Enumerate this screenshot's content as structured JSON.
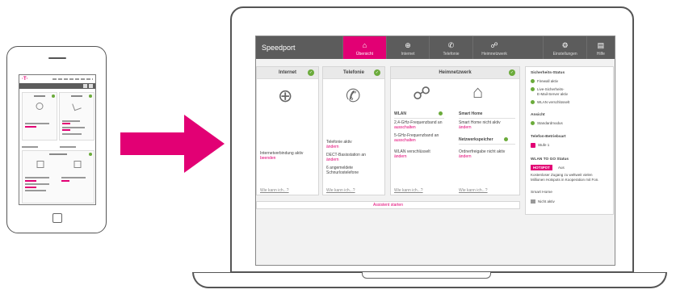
{
  "router": {
    "brand": "Speedport",
    "nav": [
      {
        "label": "Übersicht",
        "icon": "home-icon",
        "glyph": "⌂"
      },
      {
        "label": "Internet",
        "icon": "globe-icon",
        "glyph": "⊕"
      },
      {
        "label": "Telefonie",
        "icon": "phone-icon",
        "glyph": "✆"
      },
      {
        "label": "Heimnetzwerk",
        "icon": "network-icon",
        "glyph": "☍"
      },
      {
        "label": "Einstellungen",
        "icon": "gear-icon",
        "glyph": "⚙"
      },
      {
        "label": "Hilfe",
        "icon": "book-icon",
        "glyph": "▤"
      }
    ]
  },
  "internet_card": {
    "title": "Internet",
    "status": "Internetverbindung aktiv",
    "action": "beenden",
    "help": "Wie kann ich...?"
  },
  "telefonie_card": {
    "title": "Telefonie",
    "line1": "Telefonie aktiv",
    "action1": "ändern",
    "line2": "DECT-Basisstation an",
    "action2": "ändern",
    "line3a": "6 angemeldete",
    "line3b": "Schnurlostelefone",
    "help": "Wie kann ich...?"
  },
  "heimnetz_card": {
    "title": "Heimnetzwerk",
    "wlan_title": "WLAN",
    "wlan_line1": "2,4-GHz-Frequenzband an",
    "wlan_action1": "ausschalten",
    "wlan_line2": "5-GHz-Frequenzband an",
    "wlan_action2": "ausschalten",
    "wlan_line3": "WLAN verschlüsselt",
    "wlan_action3": "ändern",
    "smart_title": "Smart Home",
    "smart_line": "Smart Home nicht aktiv",
    "smart_action": "ändern",
    "nas_title": "Netzwerkspeicher",
    "nas_line": "Ordnerfreigabe nicht aktiv",
    "nas_action": "ändern",
    "help": "Wie kann ich...?"
  },
  "banner": {
    "label": "Assistent starten"
  },
  "sidebar": {
    "security_title": "Sicherheits-Status",
    "security_items": [
      "Firewall aktiv",
      "Live-Sicherheits-",
      "E-Mail-Server aktiv",
      "WLAN verschlüsselt"
    ],
    "ansicht_title": "Ansicht",
    "ansicht_value": "Standardmodus",
    "telefon_title": "Telefon-Betriebsart",
    "telefon_value": "Stufe 1",
    "wlan_to_go_title": "WLAN TO GO Status",
    "hotspot_tag": "HOTSPOT",
    "hotspot_value": "Aus",
    "hotspot_desc1": "Kostenloser Zugang zu weltweit vielen",
    "hotspot_desc2": "Millionen Hotspots in Kooperation mit Fon.",
    "smart_title": "Smart Home",
    "smart_value": "Nicht aktiv"
  },
  "colors": {
    "accent": "#e20074",
    "ok": "#6bab3b",
    "nav": "#5c5c5c"
  }
}
